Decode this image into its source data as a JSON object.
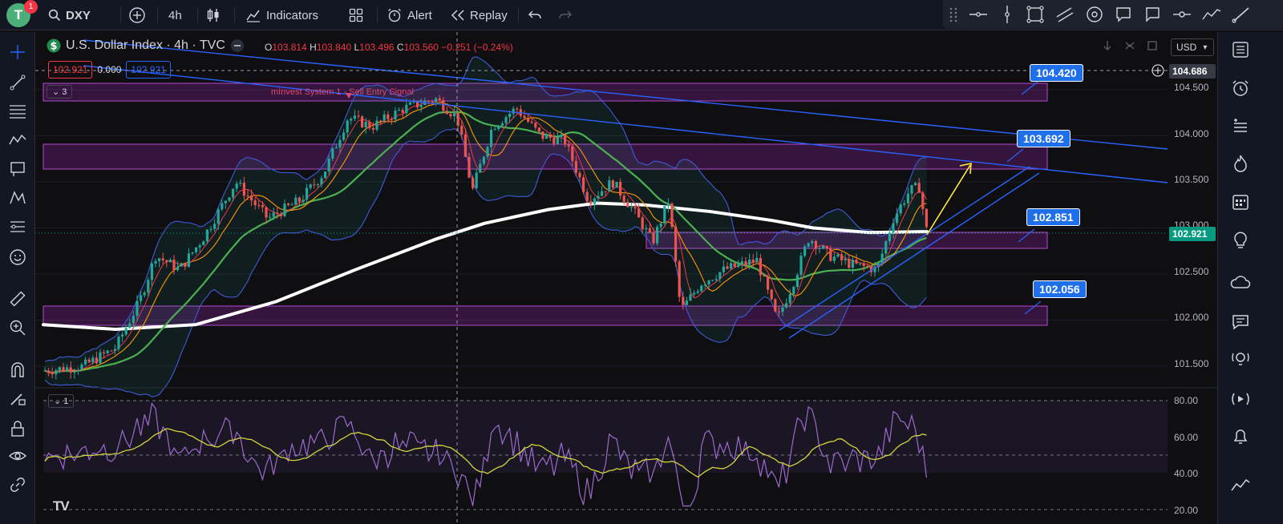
{
  "topbar": {
    "avatar_letter": "T",
    "notification_count": "1",
    "symbol": "DXY",
    "interval": "4h",
    "indicators_label": "Indicators",
    "alert_label": "Alert",
    "replay_label": "Replay"
  },
  "legend": {
    "title": "U.S. Dollar Index · 4h · TVC",
    "open_label": "O",
    "open": "103.814",
    "high_label": "H",
    "high": "103.840",
    "low_label": "L",
    "low": "103.496",
    "close_label": "C",
    "close": "103.560",
    "change": "−0.251 (−0.24%)",
    "sell_price": "102.921",
    "spread": "0.000",
    "buy_price": "102.921",
    "indicator_count": "3",
    "rsi_count": "1"
  },
  "signal_label": "mInvest System 1 - Sell Entry Signal",
  "callouts": {
    "c1": "104.420",
    "c2": "103.692",
    "c3": "102.851",
    "c4": "102.056"
  },
  "price_axis": {
    "currency": "USD",
    "ticks": [
      "104.500",
      "104.000",
      "103.500",
      "103.000",
      "102.500",
      "102.000",
      "101.500"
    ],
    "crosshair_price": "104.686",
    "last_price": "102.921",
    "rsi_ticks": [
      "80.00",
      "60.00",
      "40.00",
      "20.00"
    ]
  },
  "watermark": "TV",
  "colors": {
    "bull": "#26a69a",
    "bear": "#ef5350",
    "accent_blue": "#2962ff",
    "zone_purple": "#9c27b0",
    "last_price_green": "#089981",
    "callout_blue": "#1f6feb",
    "rsi_line": "#9c6ad0",
    "rsi_signal": "#d4d43c",
    "ma200": "#ffffff",
    "ma_green": "#4caf50",
    "ma_orange": "#ff9800"
  }
}
